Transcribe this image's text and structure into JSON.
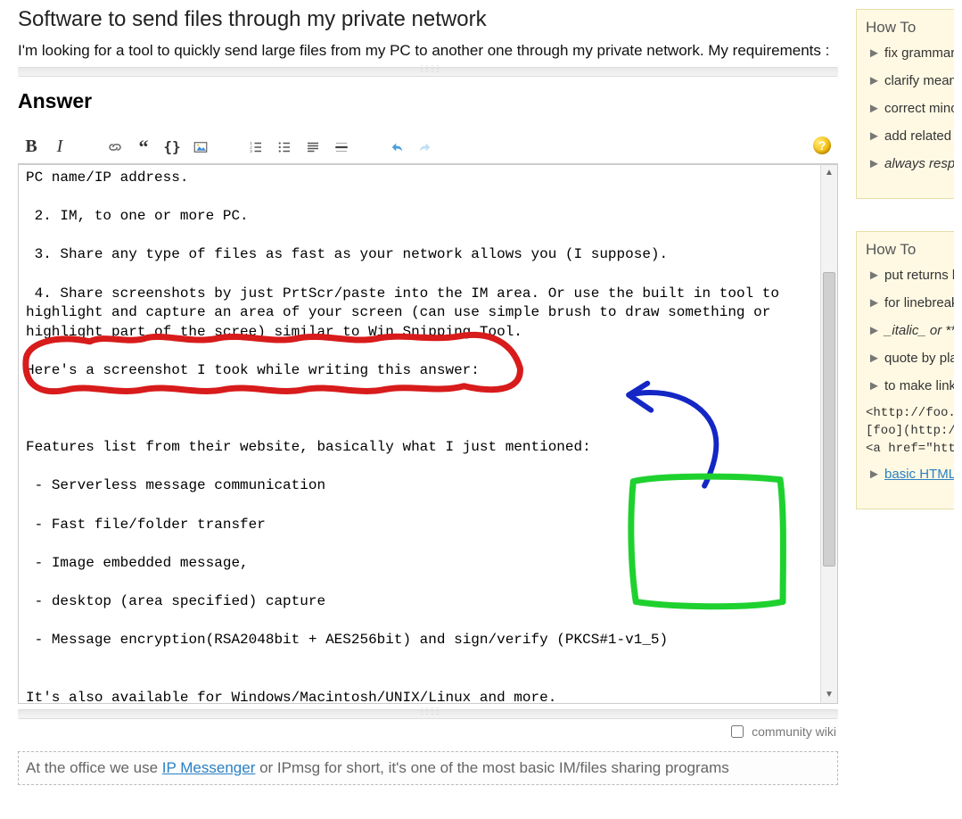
{
  "question": {
    "title": "Software to send files through my private network",
    "body": "I'm looking for a tool to quickly send large files from my PC to another one through my private network. My requirements :"
  },
  "answer_heading": "Answer",
  "community_wiki_label": "community wiki",
  "editor_text": "PC name/IP address.\n\n 2. IM, to one or more PC.\n\n 3. Share any type of files as fast as your network allows you (I suppose).\n\n 4. Share screenshots by just PrtScr/paste into the IM area. Or use the built in tool to highlight and capture an area of your screen (can use simple brush to draw something or highlight part of the scree) similar to Win Snipping Tool.\n\nHere's a screenshot I took while writing this answer:\n\n\n\nFeatures list from their website, basically what I just mentioned:\n\n - Serverless message communication\n\n - Fast file/folder transfer\n\n - Image embedded message,\n\n - desktop (area specified) capture\n\n - Message encryption(RSA2048bit + AES256bit) and sign/verify (PKCS#1-v1_5)\n\n\nIt's also available for Windows/Macintosh/UNIX/Linux and more.",
  "preview": {
    "prefix": "At the office we use ",
    "link": "IP Messenger",
    "suffix": " or IPmsg for short, it's one of the most basic IM/files sharing programs"
  },
  "sidebar": {
    "panel1": {
      "title": "How To",
      "items": [
        {
          "text": "fix grammar",
          "italic": false
        },
        {
          "text": "clarify meaning",
          "italic": false
        },
        {
          "text": "correct minor mistakes",
          "italic": false
        },
        {
          "text": "add related resources",
          "italic": false
        },
        {
          "text": "always respect",
          "italic": true
        }
      ]
    },
    "panel2": {
      "title": "How To",
      "items": [
        {
          "text": "put returns between",
          "italic": false
        },
        {
          "text": "for linebreak add",
          "italic": false
        },
        {
          "text": "_italic_ or **bold**",
          "italic": true
        },
        {
          "text": "quote by placing",
          "italic": false
        },
        {
          "text": "to make links",
          "italic": false
        }
      ],
      "mono": [
        "<http://foo.com>",
        "[foo](http://foo.com)",
        "<a href=\"http://foo.com\">foo</a>"
      ],
      "last_link": "basic HTML"
    }
  },
  "annotations": {
    "red_scribble": "freehand-circle",
    "blue_arrow": "curved-arrow",
    "green_box": "freehand-rectangle"
  }
}
